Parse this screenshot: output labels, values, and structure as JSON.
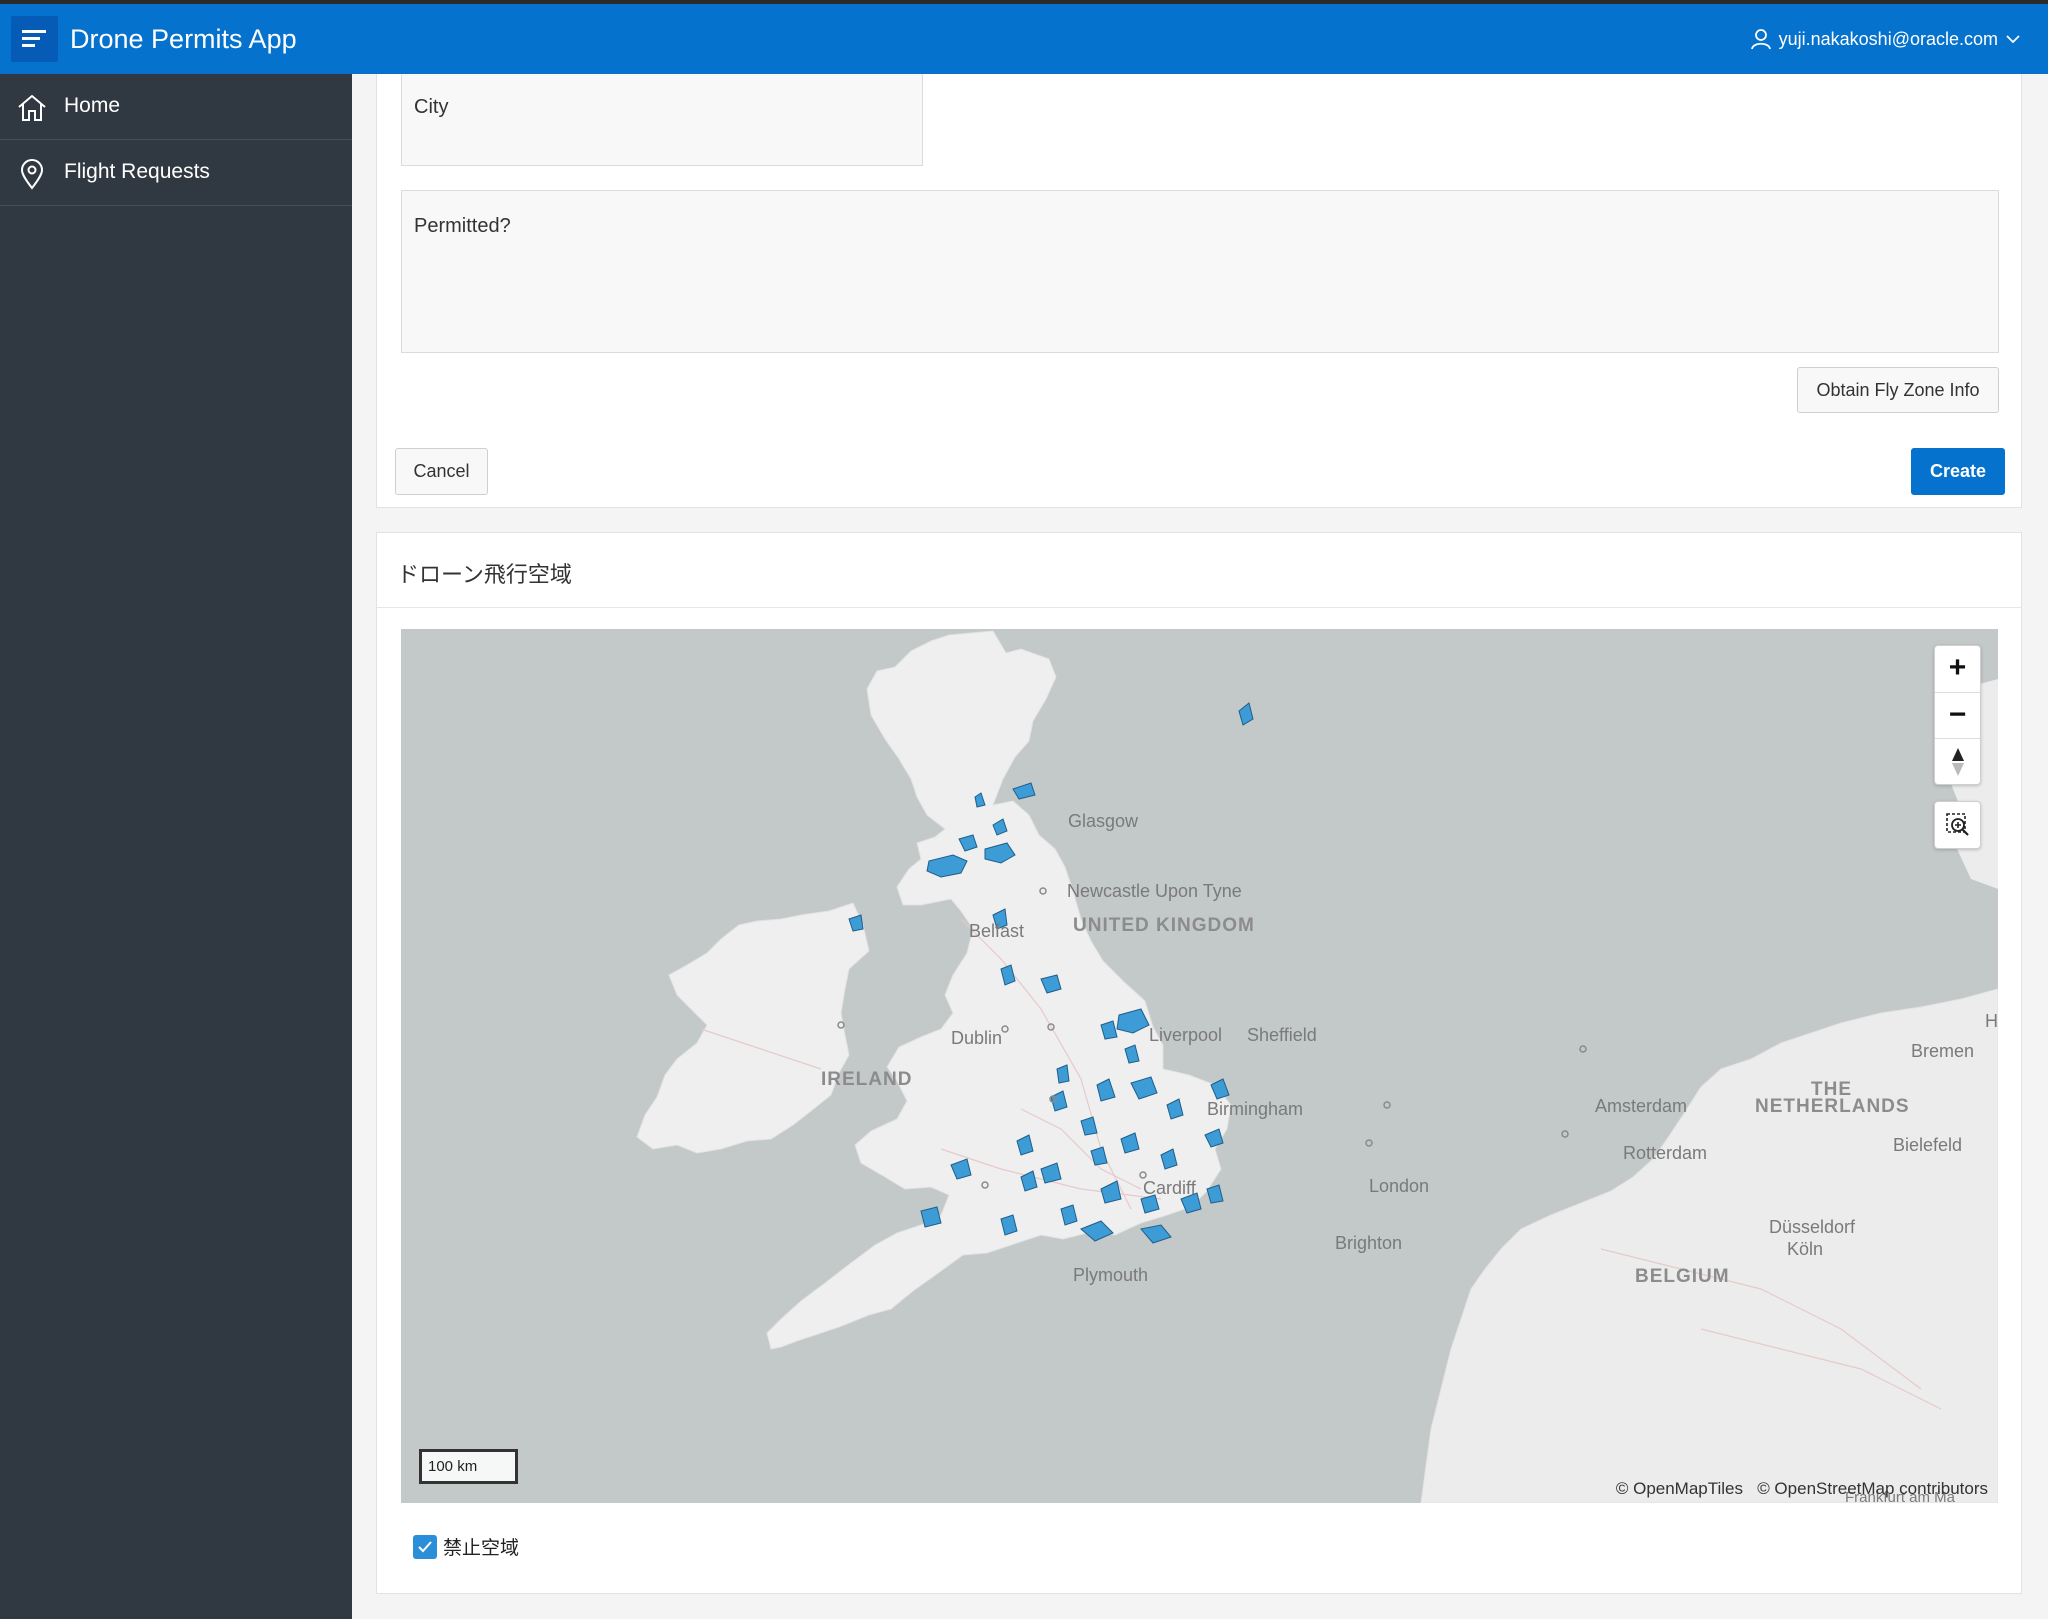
{
  "header": {
    "app_title": "Drone Permits App",
    "user": "yuji.nakakoshi@oracle.com",
    "menu_icon": "hamburger-icon",
    "user_icon": "user-icon",
    "chevron_icon": "chevron-down-icon",
    "color": "#0572ce"
  },
  "sidebar": {
    "items": [
      {
        "label": "Home",
        "icon": "home-icon"
      },
      {
        "label": "Flight Requests",
        "icon": "map-pin-icon"
      }
    ],
    "color": "#303841"
  },
  "form": {
    "city_label": "City",
    "permitted_label": "Permitted?",
    "obtain_button": "Obtain Fly Zone Info",
    "cancel_button": "Cancel",
    "create_button": "Create"
  },
  "map_region": {
    "title": "ドローン飛行空域",
    "labels": {
      "glasgow": "Glasgow",
      "newcastle": "Newcastle Upon Tyne",
      "uk": "UNITED KINGDOM",
      "belfast": "Belfast",
      "dublin": "Dublin",
      "ireland": "IRELAND",
      "liverpool": "Liverpool",
      "sheffield": "Sheffield",
      "birmingham": "Birmingham",
      "cardiff": "Cardiff",
      "london": "London",
      "brighton": "Brighton",
      "plymouth": "Plymouth",
      "amsterdam": "Amsterdam",
      "rotterdam": "Rotterdam",
      "netherlands_1": "THE",
      "netherlands_2": "NETHERLANDS",
      "bremen": "Bremen",
      "bielefeld": "Bielefeld",
      "dusseldorf": "Düsseldorf",
      "koln": "Köln",
      "belgium": "BELGIUM",
      "frankfurt": "Frankfurt am Ma",
      "edge_h": "H"
    },
    "scale": "100 km",
    "attribution_1": "© OpenMapTiles",
    "attribution_2": "© OpenStreetMap contributors",
    "controls": {
      "zoom_in": "+",
      "zoom_out": "−",
      "compass_icon": "compass-icon",
      "zoom_box_icon": "zoom-box-icon"
    },
    "legend": {
      "label": "禁止空域",
      "checked": true,
      "color": "#3d9bd6"
    }
  }
}
